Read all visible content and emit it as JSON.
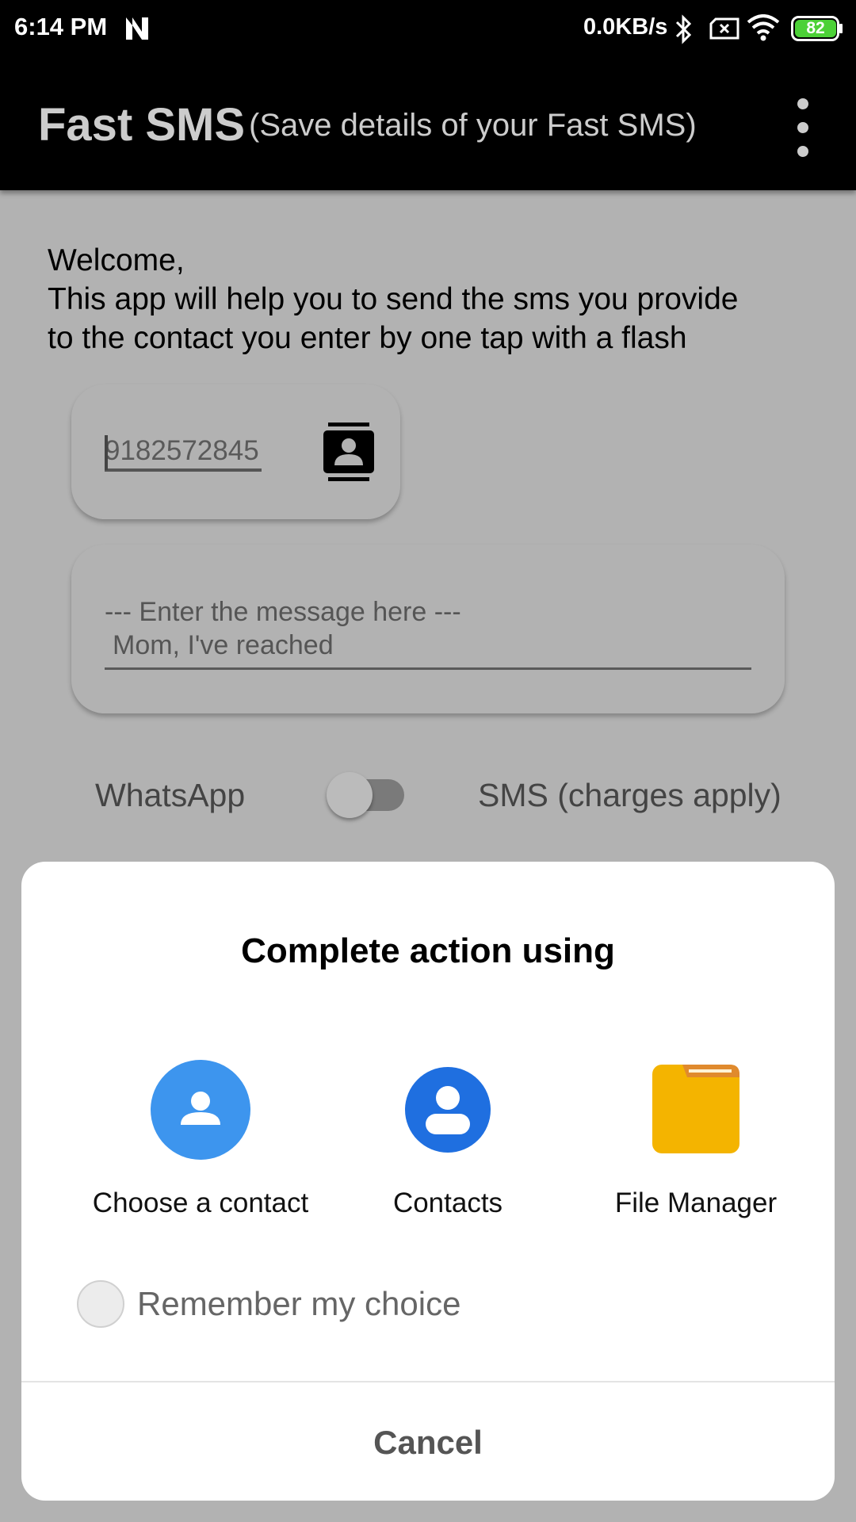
{
  "status_bar": {
    "time": "6:14 PM",
    "network_speed": "0.0KB/s",
    "battery": "82",
    "icons": [
      "n-icon",
      "bluetooth-icon",
      "sim-icon",
      "wifi-icon",
      "battery-icon"
    ]
  },
  "app_bar": {
    "title": "Fast SMS",
    "subtitle": "(Save details of your Fast SMS)",
    "menu_icon": "more-vert-icon"
  },
  "welcome": {
    "lines": [
      "Welcome,",
      "This app will help you to send the sms you provide",
      "to the contact you enter by one tap with a flash"
    ]
  },
  "phone": {
    "value": "9182572845",
    "icon": "contact-book-icon"
  },
  "message": {
    "placeholder": "--- Enter the message here ---",
    "value": "Mom, I've reached"
  },
  "send_mode": {
    "left_label": "WhatsApp",
    "right_label": "SMS (charges apply)",
    "toggle_on": false
  },
  "dialog": {
    "title": "Complete action using",
    "options": [
      {
        "label": "Choose a contact",
        "icon": "choose-contact-icon",
        "color": "#3d95ee"
      },
      {
        "label": "Contacts",
        "icon": "contacts-icon",
        "color": "#1f6fe0"
      },
      {
        "label": "File Manager",
        "icon": "file-manager-icon",
        "color": "#f4b400"
      }
    ],
    "remember_label": "Remember my choice",
    "remember_checked": false,
    "cancel_label": "Cancel"
  },
  "colors": {
    "status_bar_bg": "#000000",
    "app_bar_bg": "#000000",
    "scrim_background": "#b2b2b2",
    "dialog_bg": "#ffffff",
    "battery_fill": "#4cd137"
  }
}
